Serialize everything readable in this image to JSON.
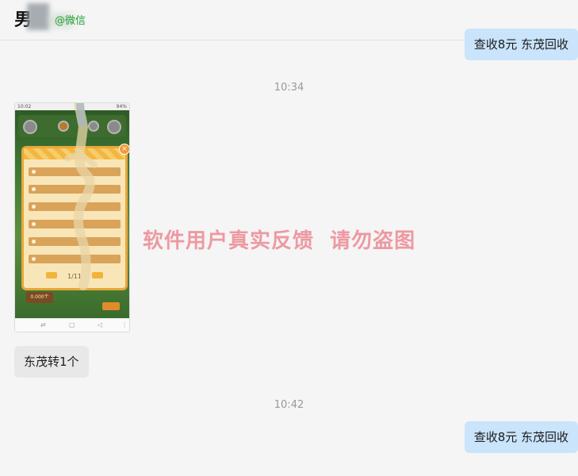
{
  "header": {
    "contact_name": "男",
    "source_tag": "@微信"
  },
  "messages": {
    "sent_top": "查收8元 东茂回收",
    "time_1": "10:34",
    "image": {
      "status_time": "10:02",
      "status_right": "94%",
      "pager": "1/11",
      "sign_value": "0.000个"
    },
    "recv_text": "东茂转1个",
    "time_2": "10:42",
    "sent_bottom": "查收8元 东茂回收"
  },
  "watermark": "软件用户真实反馈  请勿盗图",
  "colors": {
    "sent_bubble": "#c9e4fb",
    "recv_bubble": "#e8e8e8",
    "wechat_green": "#23a13a",
    "watermark": "#ec8c96"
  }
}
